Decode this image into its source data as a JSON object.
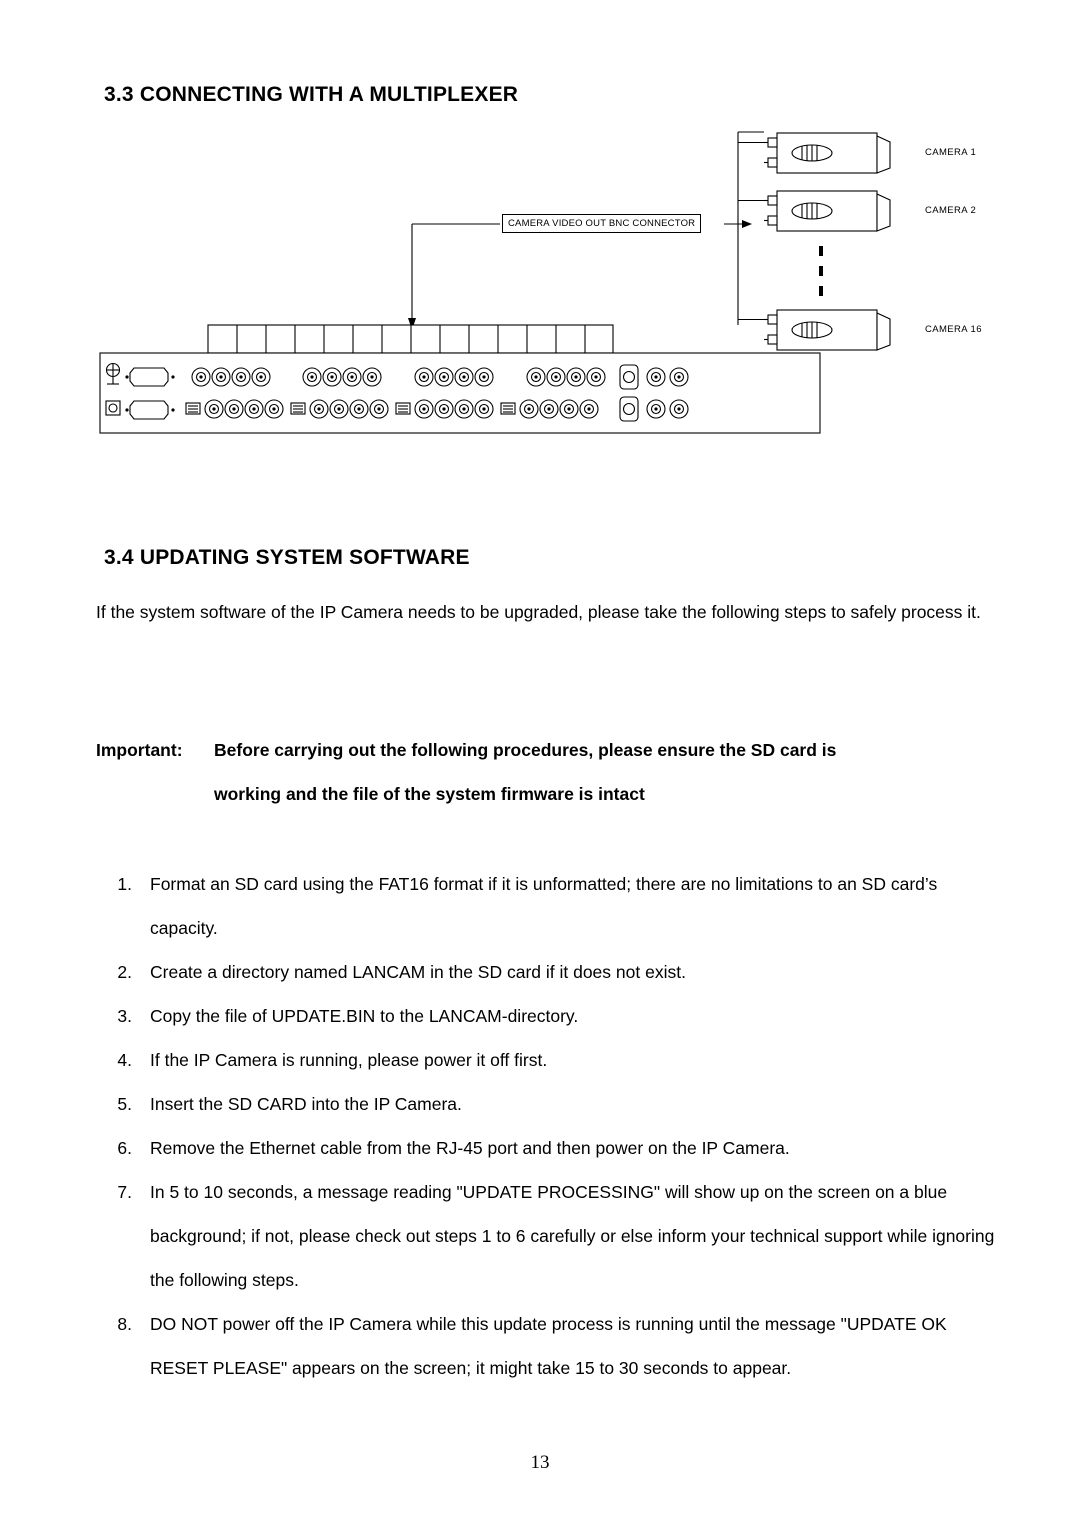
{
  "document": {
    "page_number": "13",
    "sections": [
      {
        "id": "sec33",
        "heading": "3.3 CONNECTING WITH A MULTIPLEXER"
      },
      {
        "id": "sec34",
        "heading": "3.4 UPDATING SYSTEM SOFTWARE"
      }
    ],
    "intro_paragraph": "If the system software of the IP Camera needs to be upgraded, please take the following steps to safely process it.",
    "important": {
      "label": "Important:",
      "line1": "Before carrying out the following procedures, please ensure the SD card is",
      "line2": "working and the file of the system firmware is intact"
    },
    "steps": [
      {
        "num": "1.",
        "text": "Format an SD card using the FAT16 format if it is unformatted; there are no limitations to an SD card’s capacity."
      },
      {
        "num": "2.",
        "text": "Create a directory named LANCAM in the SD card if it does not exist."
      },
      {
        "num": "3.",
        "text": "Copy the file of UPDATE.BIN to the LANCAM-directory."
      },
      {
        "num": "4.",
        "text": "If the IP Camera is running, please power it off first."
      },
      {
        "num": "5.",
        "text": "Insert the SD CARD into the IP Camera."
      },
      {
        "num": "6.",
        "text": "Remove the Ethernet cable from the RJ-45 port and then power on the IP Camera."
      },
      {
        "num": "7.",
        "text": "In 5 to 10 seconds, a message reading \"UPDATE PROCESSING\" will show up on the screen on a blue background; if not, please check out steps 1 to 6 carefully or else inform your technical support while ignoring the following steps."
      },
      {
        "num": "8.",
        "text": "DO NOT power off the IP Camera while this update process is running until the message \"UPDATE OK RESET PLEASE\" appears on the screen; it might take 15 to 30 seconds to appear."
      }
    ]
  },
  "diagram": {
    "callout": "CAMERA VIDEO OUT BNC CONNECTOR",
    "camera_labels": [
      "CAMERA 1",
      "CAMERA 2",
      "CAMERA 16"
    ],
    "vertical_ellipsis": "⋮",
    "colors": {
      "stroke": "#000000",
      "fill": "#ffffff",
      "shade": "#d9d9d9"
    }
  }
}
